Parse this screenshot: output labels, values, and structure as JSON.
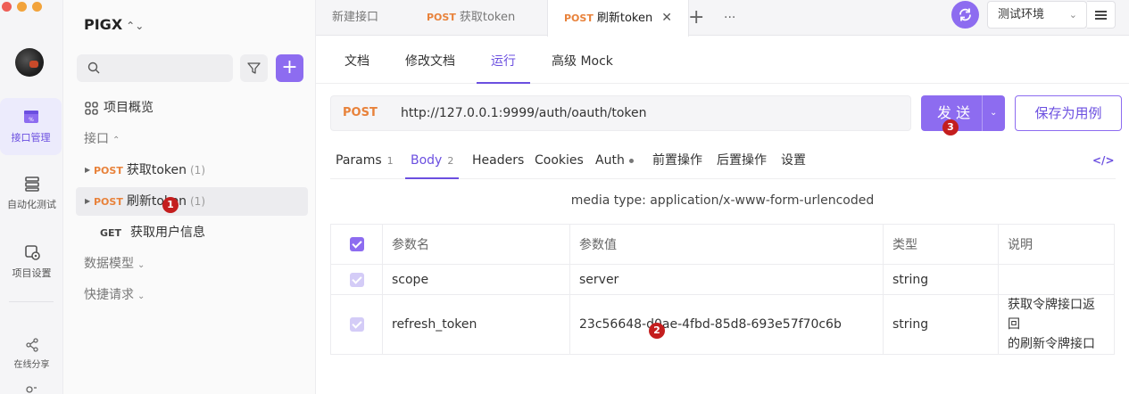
{
  "colors": {
    "accent": "#8d6cf0",
    "post": "#e8823b",
    "badge": "#c41e1e"
  },
  "rail": {
    "items": [
      {
        "label": "接口管理",
        "icon": "api-icon"
      },
      {
        "label": "自动化测试",
        "icon": "automation-icon"
      },
      {
        "label": "项目设置",
        "icon": "project-settings-icon"
      },
      {
        "label": "在线分享",
        "icon": "share-icon"
      }
    ]
  },
  "tree": {
    "project_name": "PIGX",
    "overview": "项目概览",
    "group_api": "接口",
    "items": [
      {
        "method": "POST",
        "name": "获取token",
        "count": "(1)"
      },
      {
        "method": "POST",
        "name": "刷新token",
        "count": "(1)"
      },
      {
        "method": "GET",
        "name": "获取用户信息"
      }
    ],
    "group_models": "数据模型",
    "group_requests": "快捷请求"
  },
  "badges": {
    "b1": "1",
    "b2": "2",
    "b3": "3"
  },
  "tabs": [
    {
      "label": "新建接口"
    },
    {
      "method": "POST",
      "label": "获取token"
    },
    {
      "method": "POST",
      "label": "刷新token"
    }
  ],
  "tab_more": "···",
  "env": {
    "selected": "测试环境"
  },
  "subtabs": [
    "文档",
    "修改文档",
    "运行",
    "高级 Mock"
  ],
  "request": {
    "method": "POST",
    "url": "http://127.0.0.1:9999/auth/oauth/token",
    "send_label": "发 送",
    "save_label": "保存为用例"
  },
  "reqtabs": [
    {
      "label": "Params",
      "count": "1"
    },
    {
      "label": "Body",
      "count": "2"
    },
    {
      "label": "Headers"
    },
    {
      "label": "Cookies"
    },
    {
      "label": "Auth"
    },
    {
      "label": "前置操作"
    },
    {
      "label": "后置操作"
    },
    {
      "label": "设置"
    }
  ],
  "code_icon": "</>",
  "media_type": "media type: application/x-www-form-urlencoded",
  "params": {
    "headers": [
      "参数名",
      "参数值",
      "类型",
      "说明"
    ],
    "rows": [
      {
        "name": "scope",
        "value": "server",
        "type": "string",
        "desc_1": "",
        "desc_2": ""
      },
      {
        "name": "refresh_token",
        "value": "23c56648-d0ae-4fbd-85d8-693e57f70c6b",
        "type": "string",
        "desc_1": "获取令牌接口返回",
        "desc_2": "的刷新令牌接口"
      }
    ]
  }
}
